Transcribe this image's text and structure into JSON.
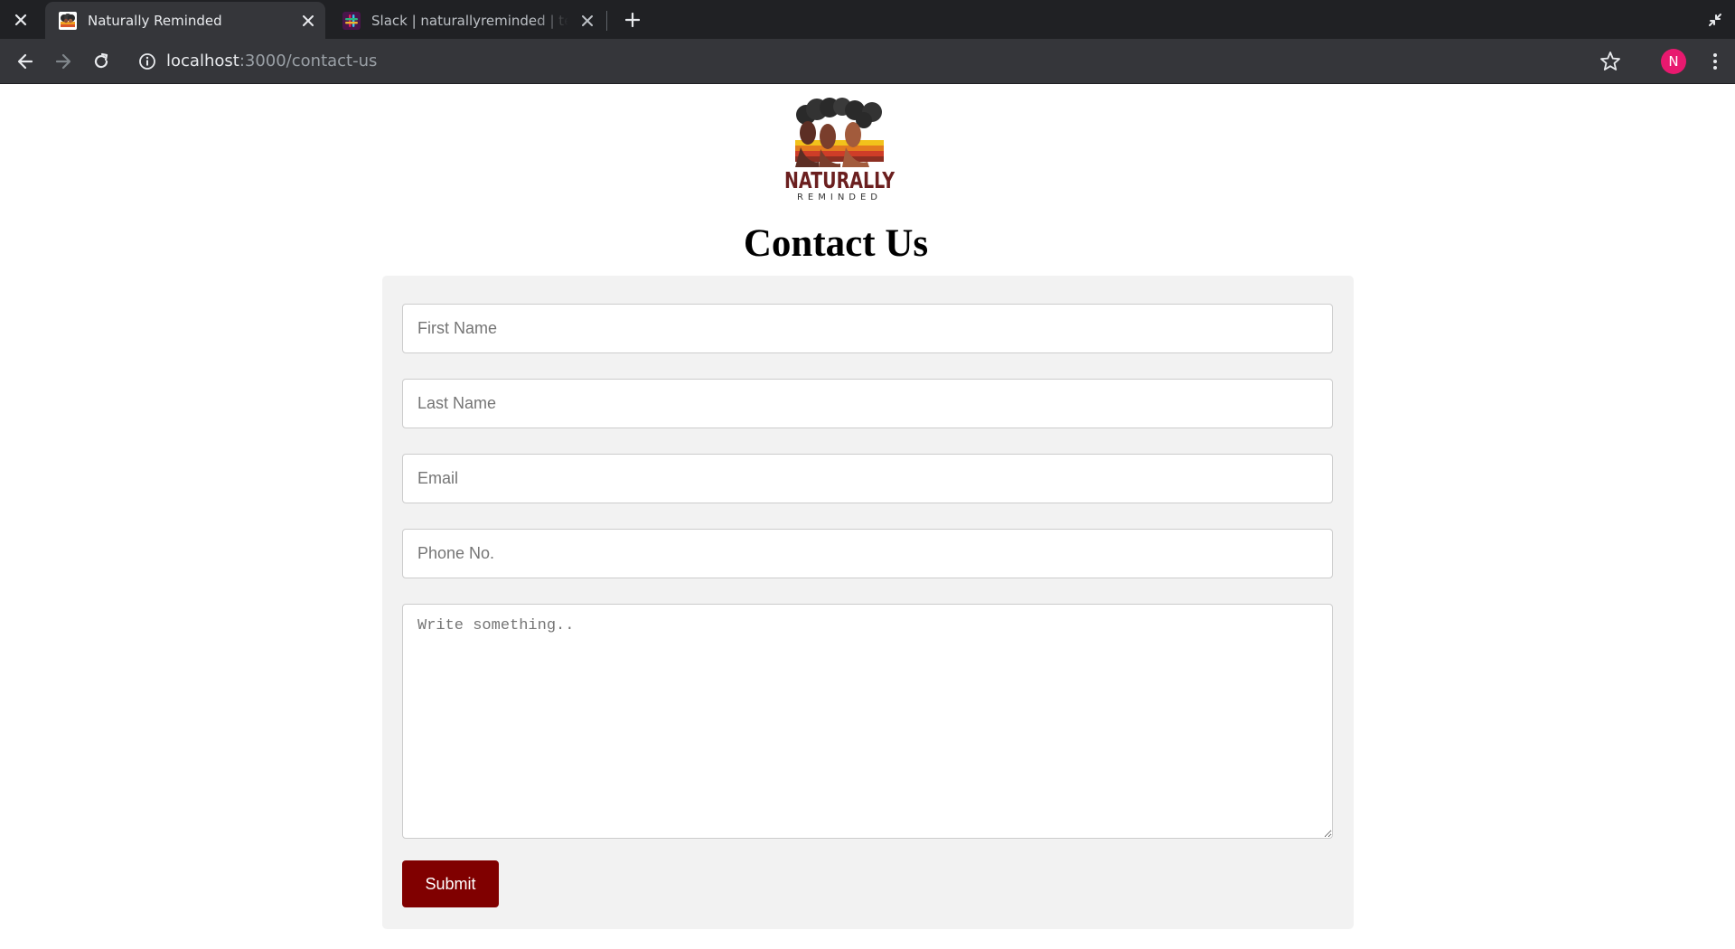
{
  "browser": {
    "tabs": [
      {
        "title": "Naturally Reminded",
        "active": true
      },
      {
        "title": "Slack | naturallyreminded | team",
        "active": false
      }
    ],
    "url": {
      "host": "localhost",
      "path": ":3000/contact-us"
    },
    "profile_initial": "N",
    "colors": {
      "tabstrip": "#202124",
      "toolbar": "#35363a",
      "avatar": "#e8196f"
    }
  },
  "logo": {
    "word": "NATURALLY",
    "subword": "REMINDED"
  },
  "page": {
    "title": "Contact Us"
  },
  "form": {
    "first_name_placeholder": "First Name",
    "last_name_placeholder": "Last Name",
    "email_placeholder": "Email",
    "phone_placeholder": "Phone No.",
    "message_placeholder": "Write something..",
    "submit_label": "Submit",
    "colors": {
      "panel": "#f2f2f2",
      "submit": "#800000"
    }
  }
}
